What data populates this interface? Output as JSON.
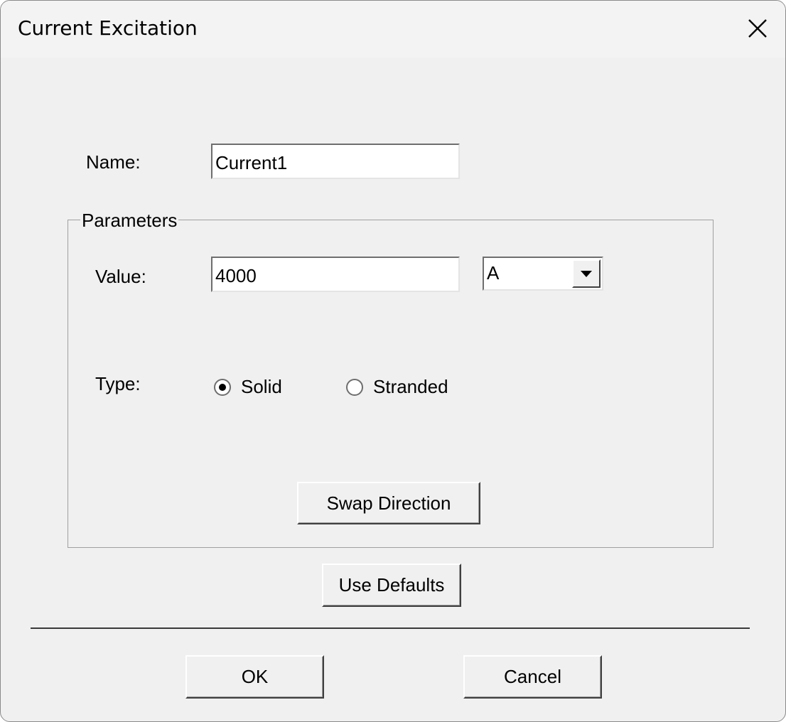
{
  "window": {
    "title": "Current Excitation"
  },
  "icons": {
    "close": "close-icon",
    "dropdown": "chevron-down-icon"
  },
  "form": {
    "name_label": "Name:",
    "name_value": "Current1",
    "group_title": "Parameters",
    "value_label": "Value:",
    "value_value": "4000",
    "unit_selected": "A",
    "type_label": "Type:",
    "type_options": [
      {
        "label": "Solid",
        "selected": true
      },
      {
        "label": "Stranded",
        "selected": false
      }
    ],
    "swap_direction_label": "Swap Direction",
    "use_defaults_label": "Use Defaults"
  },
  "footer": {
    "ok_label": "OK",
    "cancel_label": "Cancel"
  }
}
